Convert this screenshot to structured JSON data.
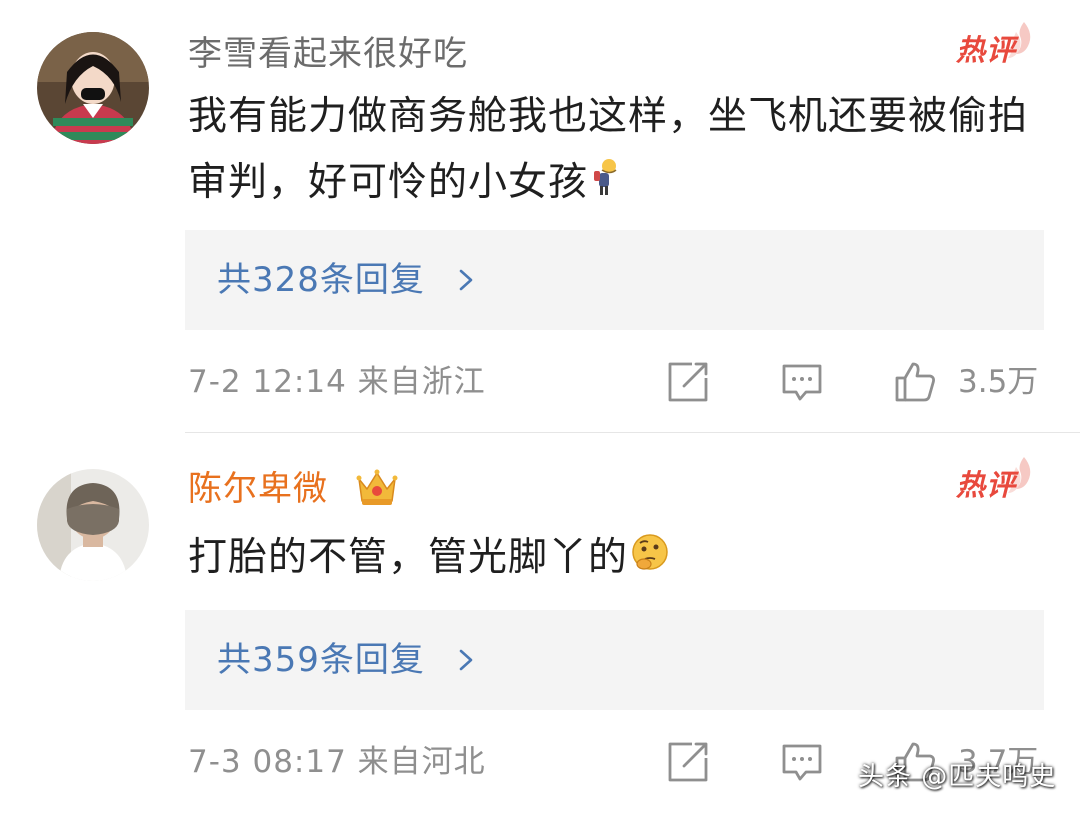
{
  "comments": [
    {
      "username": "李雪看起来很好吃",
      "hot_badge": "热评",
      "content": "我有能力做商务舱我也这样，坐飞机还要被偷拍审判，好可怜的小女孩",
      "emoji": "shrug-person-emoji",
      "replies": "共328条回复",
      "timestamp": "7-2 12:14 来自浙江",
      "likes": "3.5万"
    },
    {
      "username": "陈尔卑微",
      "hot_badge": "热评",
      "content": "打胎的不管，管光脚丫的",
      "emoji": "thinking-face-emoji",
      "replies": "共359条回复",
      "timestamp": "7-3 08:17 来自河北",
      "likes": "3.7万"
    }
  ],
  "watermark": "头条 @匹夫鸣史",
  "colors": {
    "username_gray": "#6c6c6c",
    "username_vip": "#e8711e",
    "hot_red": "#e8493d",
    "link_blue": "#4a78b4",
    "meta_gray": "#8f8f8f",
    "reply_box_bg": "#f4f4f4"
  }
}
